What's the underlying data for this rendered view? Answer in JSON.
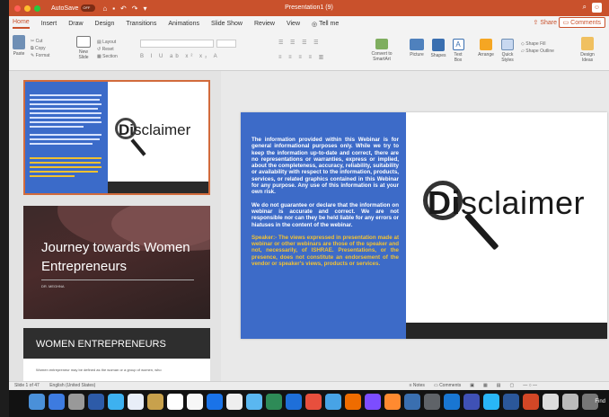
{
  "titlebar": {
    "autosave": "AutoSave",
    "autosave_state": "OFF",
    "title": "Presentation1 (9)"
  },
  "tabs": [
    "Home",
    "Insert",
    "Draw",
    "Design",
    "Transitions",
    "Animations",
    "Slide Show",
    "Review",
    "View"
  ],
  "tell_me": "Tell me",
  "share": "Share",
  "comments": "Comments",
  "ribbon": {
    "paste": "Paste",
    "cut": "Cut",
    "copy": "Copy",
    "format": "Format",
    "new_slide": "New\nSlide",
    "layout": "Layout",
    "reset": "Reset",
    "section": "Section",
    "convert": "Convert to\nSmartArt",
    "picture": "Picture",
    "shapes": "Shapes",
    "text_box": "Text\nBox",
    "arrange": "Arrange",
    "quick_styles": "Quick\nStyles",
    "shape_fill": "Shape Fill",
    "shape_outline": "Shape Outline",
    "design_ideas": "Design\nIdeas"
  },
  "slide1": {
    "body1": "The information provided within this Webinar is for general informational purposes only. While we try to keep the information up-to-date and correct, there are no representations or warranties, express or implied, about the completeness, accuracy, reliability, suitability or availability with respect to the information, products, services, or related graphics contained in this Webinar for any purpose. Any use of this information is at your own risk.",
    "body2": "We do not guarantee or declare that the information on webinar is accurate and correct. We are not responsible nor can they be held liable for any errors or hiatuses in the content of the webinar.",
    "speaker": "Speaker:- The views expressed in presentation made at webinar or other webinars are those of the speaker and not, necessarily, of ISHRAE. Presentations, or the presence, does not constitute an endorsement of the vendor or speaker's views, products or services.",
    "disclaimer_d": "Di",
    "disclaimer_rest": "sclaimer"
  },
  "slide2": {
    "title": "Journey towards Women Entrepreneurs",
    "subtitle": "DR. MEGHNA"
  },
  "slide3": {
    "title": "WOMEN ENTREPRENEURS",
    "text": "Women entrepreneur may be defined as the woman or a group of women, who"
  },
  "status": {
    "slide": "Slide 1 of 47",
    "language": "English (United States)",
    "notes": "Notes",
    "comments": "Comments"
  },
  "dock": {
    "find": "Find"
  }
}
